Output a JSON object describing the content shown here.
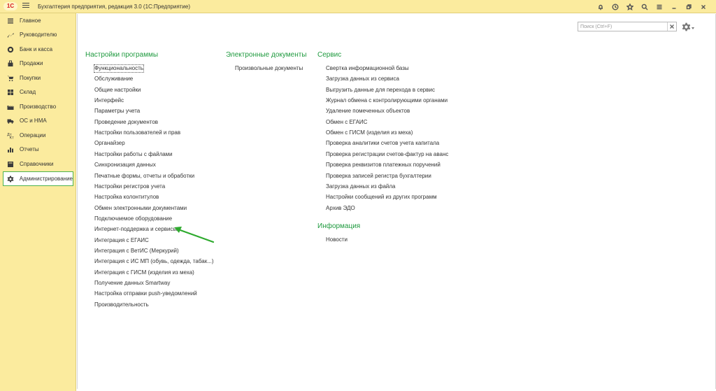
{
  "app": {
    "logo": "1С",
    "title": "Бухгалтерия предприятия, редакция 3.0  (1С:Предприятие)"
  },
  "titlebar_icons": [
    "bell-icon",
    "history-icon",
    "star-icon",
    "search-icon",
    "settings-icon",
    "minimize-icon",
    "restore-icon",
    "close-icon"
  ],
  "sidebar": {
    "items": [
      {
        "label": "Главное",
        "icon": "menu-icon"
      },
      {
        "label": "Руководителю",
        "icon": "trend-icon"
      },
      {
        "label": "Банк и касса",
        "icon": "coins-icon"
      },
      {
        "label": "Продажи",
        "icon": "bag-icon"
      },
      {
        "label": "Покупки",
        "icon": "cart-icon"
      },
      {
        "label": "Склад",
        "icon": "warehouse-icon"
      },
      {
        "label": "Производство",
        "icon": "factory-icon"
      },
      {
        "label": "ОС и НМА",
        "icon": "truck-icon"
      },
      {
        "label": "Операции",
        "icon": "operations-icon"
      },
      {
        "label": "Отчеты",
        "icon": "chart-icon"
      },
      {
        "label": "Справочники",
        "icon": "book-icon"
      },
      {
        "label": "Администрирование",
        "icon": "gear-icon",
        "active": true
      }
    ]
  },
  "search": {
    "placeholder": "Поиск (Ctrl+F)"
  },
  "sections": {
    "settings": {
      "title": "Настройки программы",
      "links": [
        "Функциональность",
        "Обслуживание",
        "Общие настройки",
        "Интерфейс",
        "Параметры учета",
        "Проведение документов",
        "Настройки пользователей и прав",
        "Органайзер",
        "Настройки работы с файлами",
        "Синхронизация данных",
        "Печатные формы, отчеты и обработки",
        "Настройки регистров учета",
        "Настройка колонтитулов",
        "Обмен электронными документами",
        "Подключаемое оборудование",
        "Интернет-поддержка и сервисы",
        "Интеграция с ЕГАИС",
        "Интеграция с ВетИС (Меркурий)",
        "Интеграция с ИС МП (обувь, одежда, табак...)",
        "Интеграция с ГИСМ (изделия из меха)",
        "Получение данных Smartway",
        "Настройка отправки push-уведомлений",
        "Производительность"
      ]
    },
    "edocs": {
      "title": "Электронные документы",
      "links": [
        "Произвольные документы"
      ]
    },
    "service": {
      "title": "Сервис",
      "links": [
        "Свертка информационной базы",
        "Загрузка данных из сервиса",
        "Выгрузить данные для перехода в сервис",
        "Журнал обмена с контролирующими органами",
        "Удаление помеченных объектов",
        "Обмен с ЕГАИС",
        "Обмен с ГИСМ (изделия из меха)",
        "Проверка аналитики счетов учета капитала",
        "Проверка регистрации счетов-фактур на аванс",
        "Проверка реквизитов платежных поручений",
        "Проверка записей регистра бухгалтерии",
        "Загрузка данных из файла",
        "Настройки сообщений из других программ",
        "Архив ЭДО"
      ]
    },
    "info": {
      "title": "Информация",
      "links": [
        "Новости"
      ]
    }
  },
  "colors": {
    "panel": "#fbeb9e",
    "section_title": "#1f9a3f",
    "arrow": "#2eaa2e",
    "active_border": "#4db24d"
  }
}
